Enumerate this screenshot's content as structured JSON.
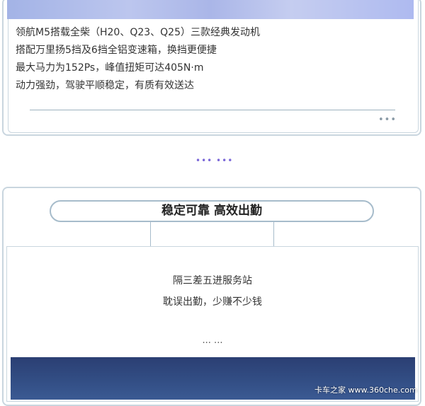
{
  "description": {
    "lines": [
      "领航M5搭载全柴（H20、Q23、Q25）三款经典发动机",
      "搭配万里扬5挡及6挡全铝变速箱，换挡更便捷",
      "最大马力为152Ps，峰值扭矩可达405N·m",
      "动力强劲，驾驶平顺稳定，有质有效送达"
    ],
    "more_label": "•••"
  },
  "separator": "••• •••",
  "section2": {
    "heading": "稳定可靠 高效出勤",
    "lines": [
      "隔三差五进服务站",
      "耽误出勤，少赚不少钱"
    ],
    "ellipsis": "... ..."
  },
  "watermark": "卡车之家 www.360che.com"
}
